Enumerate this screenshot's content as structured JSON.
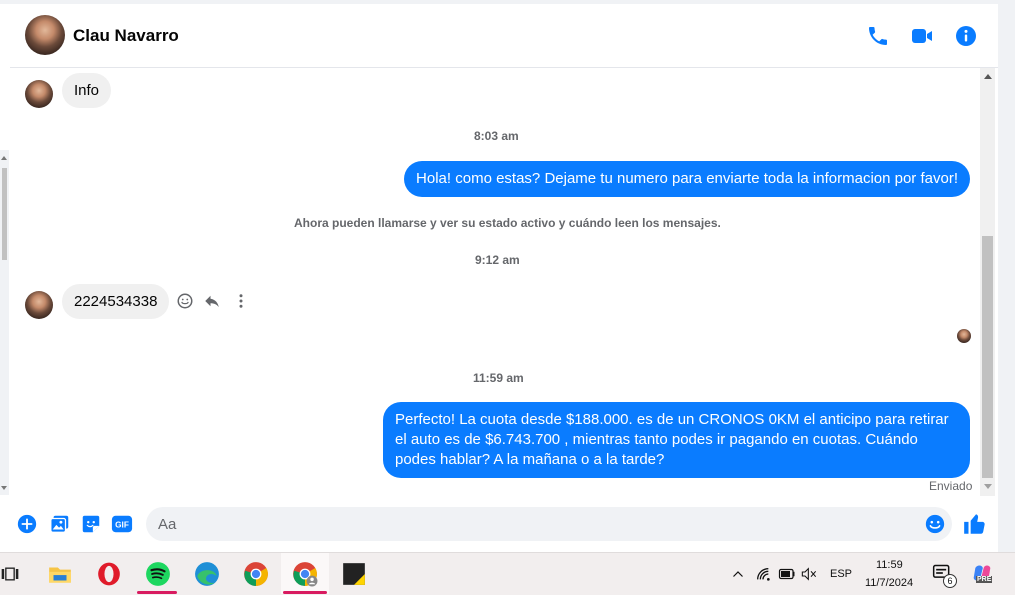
{
  "contact": {
    "name": "Clau Navarro"
  },
  "colors": {
    "accent": "#0a7cff",
    "incoming_bubble": "#f0f0f0",
    "muted_text": "#65676b",
    "taskbar": "#f2eeee"
  },
  "header_actions": [
    {
      "name": "phone-icon"
    },
    {
      "name": "video-camera-icon"
    },
    {
      "name": "info-icon"
    }
  ],
  "messages": {
    "info_bubble": "Info",
    "time_1": "8:03 am",
    "out_1": "Hola! como estas? Dejame tu numero para enviarte toda la informacion por favor!",
    "system_notice": "Ahora pueden llamarse y ver su estado activo y cuándo leen los mensajes.",
    "time_2": "9:12 am",
    "in_number": "2224534338",
    "time_3": "11:59 am",
    "out_2": "Perfecto! La cuota desde $188.000. es de un CRONOS 0KM el anticipo para retirar el auto es de $6.743.700 , mientras tanto podes ir pagando en cuotas. Cuándo podes hablar? A la mañana o a la tarde?",
    "status": "Enviado"
  },
  "message_actions": [
    {
      "name": "react-emoji-icon"
    },
    {
      "name": "reply-icon"
    },
    {
      "name": "more-options-icon"
    }
  ],
  "composer": {
    "placeholder": "Aa",
    "actions": [
      "plus-icon",
      "image-icon",
      "sticker-icon",
      "gif-icon",
      "emoji-icon",
      "thumbs-up-icon"
    ],
    "gif_label": "GIF"
  },
  "taskbar": {
    "apps": [
      "task-view-icon",
      "file-explorer-icon",
      "opera-icon",
      "spotify-icon",
      "edge-icon",
      "chrome-icon",
      "chrome-profile-icon",
      "sticky-notes-icon"
    ],
    "language": "ESP",
    "time": "11:59",
    "date": "11/7/2024",
    "notification_count": "6",
    "copilot_badge": "PRE"
  }
}
